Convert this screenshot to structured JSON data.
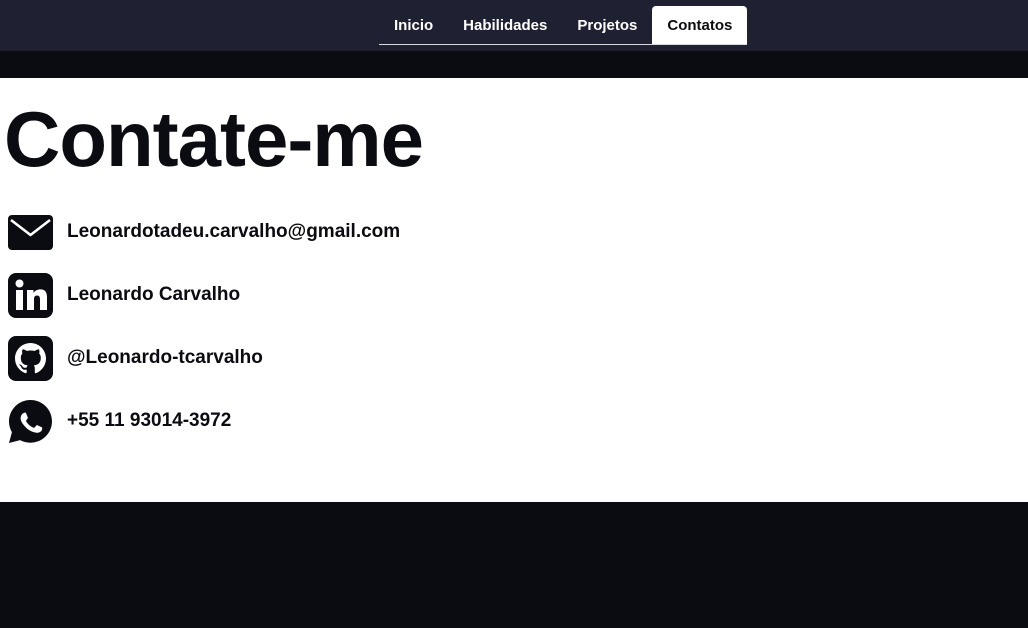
{
  "nav": {
    "tabs": [
      {
        "label": "Inicio",
        "active": false
      },
      {
        "label": "Habilidades",
        "active": false
      },
      {
        "label": "Projetos",
        "active": false
      },
      {
        "label": "Contatos",
        "active": true
      }
    ]
  },
  "main": {
    "title": "Contate-me",
    "contacts": [
      {
        "icon": "email-icon",
        "text": "Leonardotadeu.carvalho@gmail.com"
      },
      {
        "icon": "linkedin-icon",
        "text": "Leonardo Carvalho"
      },
      {
        "icon": "github-icon",
        "text": "@Leonardo-tcarvalho"
      },
      {
        "icon": "whatsapp-icon",
        "text": "+55 11 93014-3972"
      }
    ]
  },
  "colors": {
    "nav_bg": "#1f2133",
    "page_dark": "#0b0b12",
    "content_bg": "#ffffff",
    "text": "#0b0b12"
  }
}
